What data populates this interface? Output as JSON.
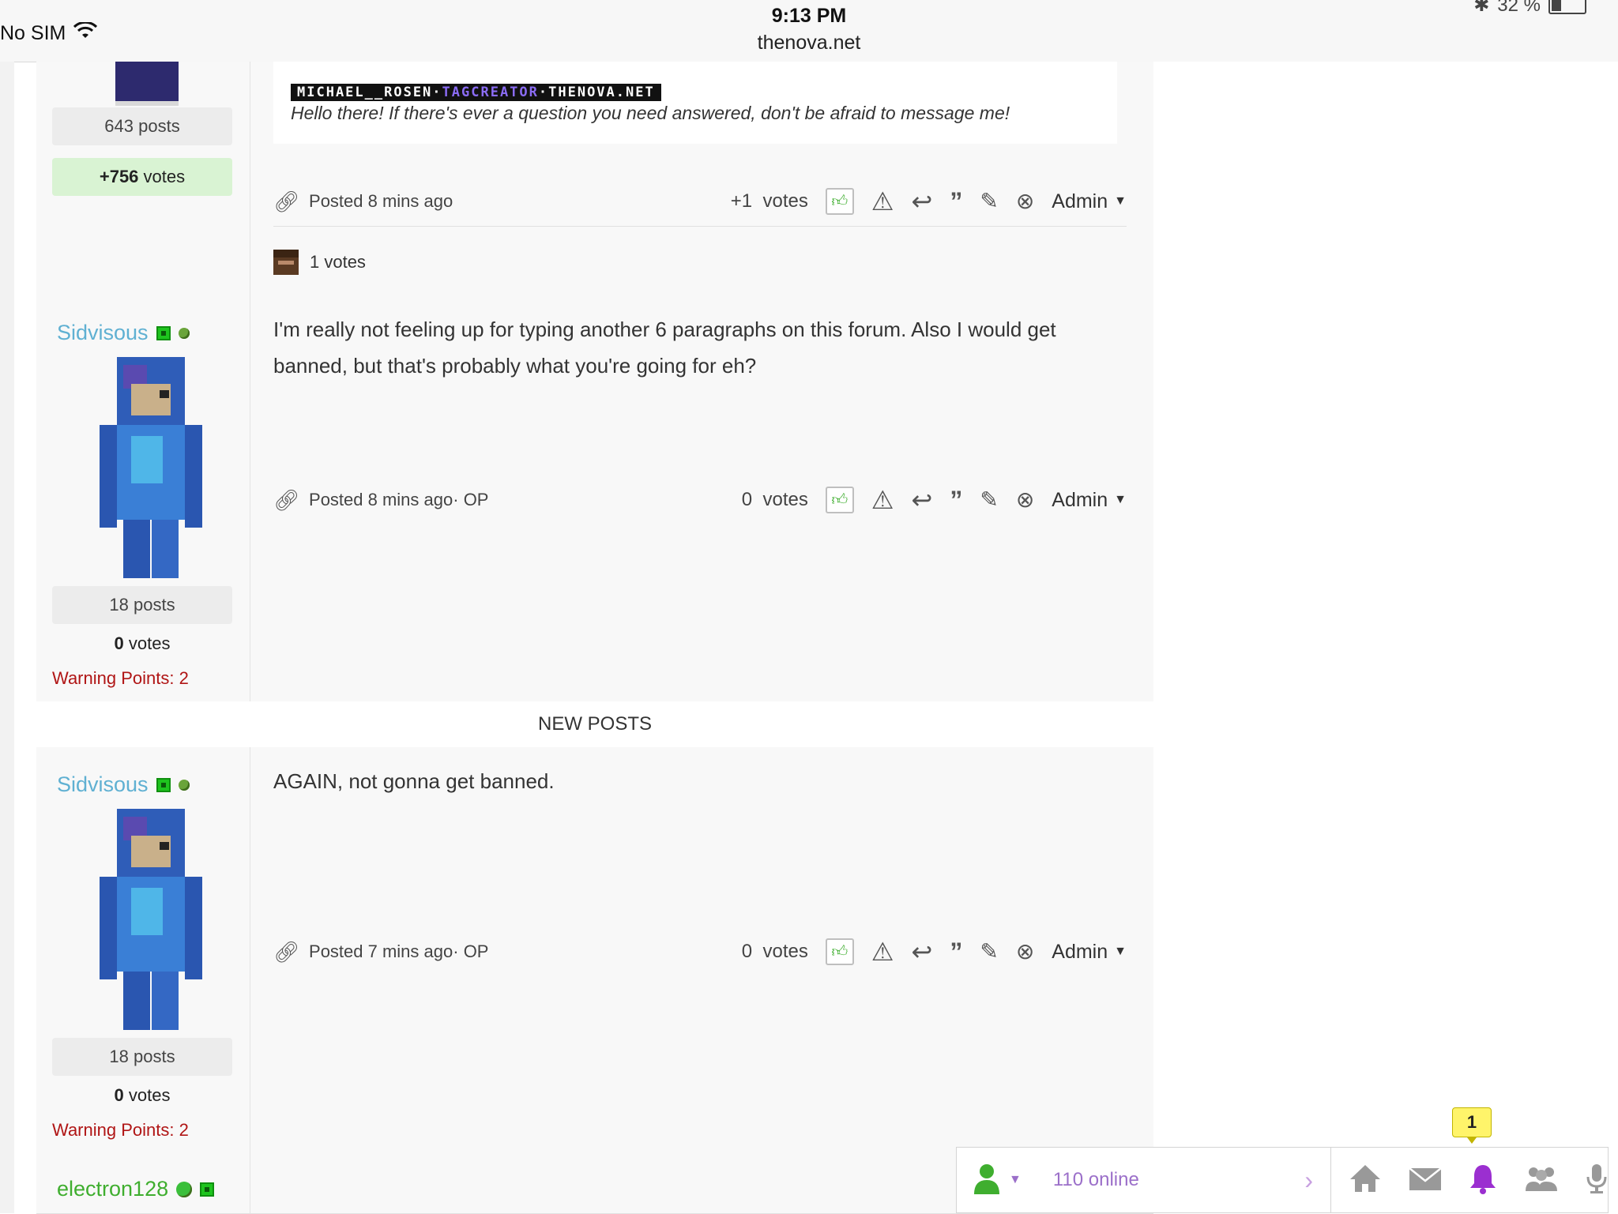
{
  "status_bar": {
    "carrier": "No SIM",
    "time": "9:13 PM",
    "url": "thenova.net",
    "battery": "32 %"
  },
  "post1": {
    "posts_count": "643 posts",
    "votes_value": "+756",
    "votes_label": "votes",
    "signature_banner": {
      "part1": "MICHAEL__ROSEN·",
      "part2": "TAGCREATOR",
      "part3": "·THENOVA.NET"
    },
    "signature_text": "Hello there! If there's ever a question you need answered, don't be afraid to message me!",
    "posted": "Posted 8 mins ago",
    "vote_count": "+1",
    "votes_word": "votes",
    "admin_label": "Admin",
    "voters_label": "1 votes"
  },
  "post2": {
    "username": "Sidvisous",
    "text": "I'm really not feeling up for typing another 6 paragraphs on this forum. Also I would get banned, but that's probably what you're going for eh?",
    "posted": "Posted 8 mins ago",
    "op": " · OP",
    "vote_count": "0",
    "votes_word": "votes",
    "admin_label": "Admin",
    "posts_count": "18 posts",
    "votes_value": "0",
    "votes_label": "votes",
    "warning": "Warning Points: 2"
  },
  "new_posts_label": "NEW POSTS",
  "post3": {
    "username": "Sidvisous",
    "text": "AGAIN, not gonna get banned.",
    "posted": "Posted 7 mins ago",
    "op": " · OP",
    "vote_count": "0",
    "votes_word": "votes",
    "admin_label": "Admin",
    "posts_count": "18 posts",
    "votes_value": "0",
    "votes_label": "votes",
    "warning": "Warning Points: 2"
  },
  "post4": {
    "username": "electron128"
  },
  "bottom_bar": {
    "online_text": "110 online",
    "notification_count": "1",
    "icons": [
      "home-icon",
      "mail-icon",
      "bell-icon",
      "users-icon",
      "microphone-icon"
    ]
  },
  "colors": {
    "username": "#5fb0d2",
    "warning": "#b01515",
    "online_text": "#9b6fc9",
    "bell_active": "#9b2fd0",
    "positive_votes_bg": "#d9f3d3"
  }
}
